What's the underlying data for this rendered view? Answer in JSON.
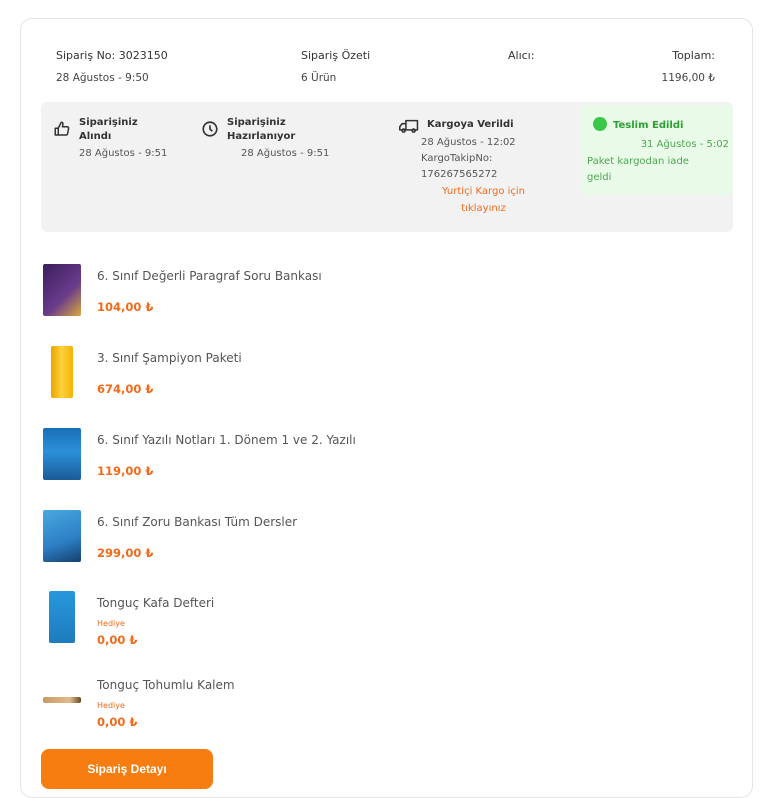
{
  "order": {
    "no_label": "Sipariş No: 3023150",
    "date": "28 Ağustos - 9:50",
    "summary_label": "Sipariş Özeti",
    "summary_value": "6 Ürün",
    "receiver_label": "Alıcı:",
    "total_label": "Toplam:",
    "total_value": "1196,00 ₺"
  },
  "status": {
    "received": {
      "title_1": "Siparişiniz",
      "title_2": "Alındı",
      "date": "28 Ağustos - 9:51",
      "icon": "thumbs-up-icon"
    },
    "preparing": {
      "title_1": "Siparişiniz",
      "title_2": "Hazırlanıyor",
      "date": "28 Ağustos - 9:51",
      "icon": "clock-icon"
    },
    "shipped": {
      "title": "Kargoya Verildi",
      "date": "28 Ağustos - 12:02",
      "tracking_label": "KargoTakipNo:",
      "tracking_no": "176267565272",
      "link_1": "Yurtiçi Kargo için",
      "link_2": "tıklayınız",
      "icon": "truck-icon"
    },
    "delivered": {
      "title": "Teslim Edildi",
      "date": "31 Ağustos - 5:02",
      "note_1": "Paket kargodan iade",
      "note_2": "geldi",
      "icon": "check-circle-icon",
      "color": "#38c748"
    }
  },
  "products": [
    {
      "name": "6. Sınıf Değerli Paragraf Soru Bankası",
      "price": "104,00 ₺",
      "gift": ""
    },
    {
      "name": "3. Sınıf Şampiyon Paketi",
      "price": "674,00 ₺",
      "gift": ""
    },
    {
      "name": "6. Sınıf Yazılı Notları 1. Dönem 1 ve 2. Yazılı",
      "price": "119,00 ₺",
      "gift": ""
    },
    {
      "name": "6. Sınıf Zoru Bankası Tüm Dersler",
      "price": "299,00 ₺",
      "gift": ""
    },
    {
      "name": "Tonguç Kafa Defteri",
      "price": "0,00 ₺",
      "gift": "Hediye"
    },
    {
      "name": "Tonguç Tohumlu Kalem",
      "price": "0,00 ₺",
      "gift": "Hediye"
    }
  ],
  "button": {
    "label": "Sipariş Detayı"
  },
  "colors": {
    "accent": "#f26a1b",
    "button": "#f77d10",
    "success": "#2e9e35"
  }
}
